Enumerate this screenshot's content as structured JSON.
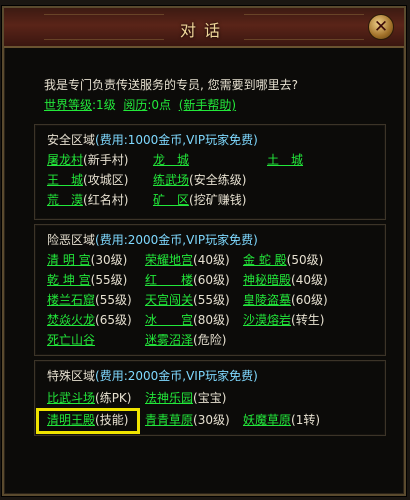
{
  "dialog": {
    "title": "对话",
    "close_label": "✕"
  },
  "intro": "我是专门负责传送服务的专员, 您需要到哪里去?",
  "stats": {
    "world_level_label": "世界等级",
    "world_level_value": ":1级",
    "experience_label": "阅历",
    "experience_value": ":0点",
    "help_label": "(新手帮助)"
  },
  "sections": [
    {
      "name": "安全区域",
      "cost": "(费用:1000金币,VIP玩家免费)",
      "items": [
        {
          "name": "屠龙村",
          "note": "(新手村)"
        },
        {
          "name": "龙　城",
          "note": ""
        },
        {
          "name": "土　城",
          "note": ""
        },
        {
          "name": "王　城",
          "note": "(攻城区)"
        },
        {
          "name": "练武场",
          "note": "(安全练级)"
        },
        {
          "name": "荒　漠",
          "note": "(红名村)"
        },
        {
          "name": "矿　区",
          "note": "(挖矿赚钱)"
        }
      ]
    },
    {
      "name": "险恶区域",
      "cost": "(费用:2000金币,VIP玩家免费)",
      "items": [
        {
          "name": "清 明 宫",
          "note": "(30级)"
        },
        {
          "name": "荣耀地宫",
          "note": "(40级)"
        },
        {
          "name": "金 蛇 殿",
          "note": "(50级)"
        },
        {
          "name": "乾 坤 宫",
          "note": "(55级)"
        },
        {
          "name": "红　　楼",
          "note": "(60级)"
        },
        {
          "name": "神秘暗殿",
          "note": "(40级)"
        },
        {
          "name": "楼兰石窟",
          "note": "(55级)"
        },
        {
          "name": "天宫闯关",
          "note": "(55级)"
        },
        {
          "name": "皇陵盗墓",
          "note": "(60级)"
        },
        {
          "name": "焚焱火龙",
          "note": "(65级)"
        },
        {
          "name": "冰　　宫",
          "note": "(80级)"
        },
        {
          "name": "沙漠熔岩",
          "note": "(转生)"
        },
        {
          "name": "死亡山谷",
          "note": ""
        },
        {
          "name": "迷雾沼泽",
          "note": "(危险)"
        }
      ]
    },
    {
      "name": "特殊区域",
      "cost": "(费用:2000金币,VIP玩家免费)",
      "items": [
        {
          "name": "比武斗场",
          "note": "(练PK)"
        },
        {
          "name": "法神乐园",
          "note": "(宝宝)"
        },
        {
          "name": "清明王殿",
          "note": "(技能)"
        },
        {
          "name": "青青草原",
          "note": "(30级)"
        },
        {
          "name": "妖魔草原",
          "note": "(1转)"
        }
      ]
    }
  ],
  "colors": {
    "link": "#22e83a",
    "cost": "#7fd9ff",
    "text": "#e6e0d0",
    "highlight": "#f0e400",
    "title": "#f0d79a"
  }
}
